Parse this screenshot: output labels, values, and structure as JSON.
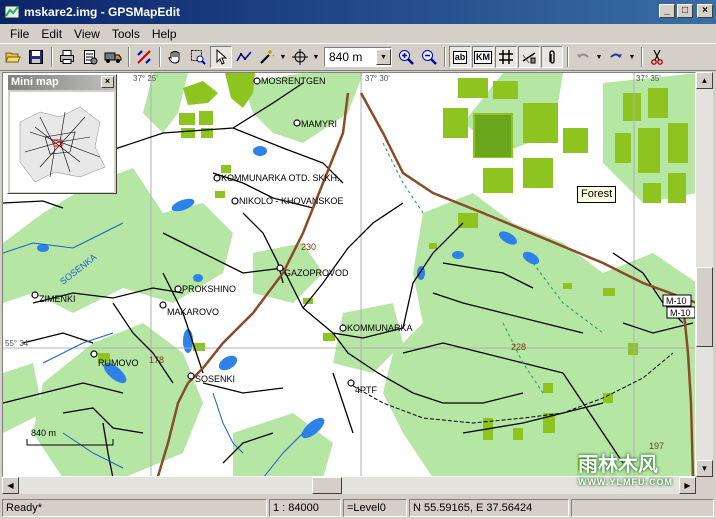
{
  "window": {
    "title": "mskare2.img - GPSMapEdit",
    "minimize_glyph": "_",
    "maximize_glyph": "□",
    "close_glyph": "×"
  },
  "menu": {
    "items": [
      {
        "label": "File"
      },
      {
        "label": "Edit"
      },
      {
        "label": "View"
      },
      {
        "label": "Tools"
      },
      {
        "label": "Help"
      }
    ]
  },
  "toolbar": {
    "zoom_value": "840 m",
    "label_toggle": "ab",
    "km_toggle": "KM"
  },
  "minimap": {
    "title": "Mini map",
    "close_glyph": "×"
  },
  "map": {
    "tooltip": "Forest",
    "scale_bar_label": "840 m",
    "places": [
      "MOSRENTGEN",
      "MAMYRI",
      "KOMMUNARKA OTD. SKKH.",
      "NIKOLO - KHOVANSKOE",
      "GAZOPROVOD",
      "PROKSHINO",
      "MAKAROVO",
      "ZIMENKI",
      "KOMMUNARKA",
      "SOSENKI",
      "4PTF",
      "RUMOVO"
    ],
    "river_label": "SOSENKA",
    "road_numbers": [
      "230",
      "228",
      "178",
      "197"
    ],
    "highway_shields": [
      "M-10",
      "M-10"
    ],
    "coords": [
      "37° 25'",
      "37° 30'",
      "37° 35'",
      "55° 34'"
    ]
  },
  "watermark": {
    "line1": "雨林木风",
    "line2": "WWW.YLMFU.COM"
  },
  "statusbar": {
    "status": "Ready*",
    "scale": "1 : 84000",
    "level": "=Level0",
    "position": "N 55.59165, E 37.56424"
  },
  "colors": {
    "forest": "#b5e6a3",
    "urban": "#8dc41f",
    "water": "#2c82e6",
    "major_road": "#8a4b28"
  }
}
